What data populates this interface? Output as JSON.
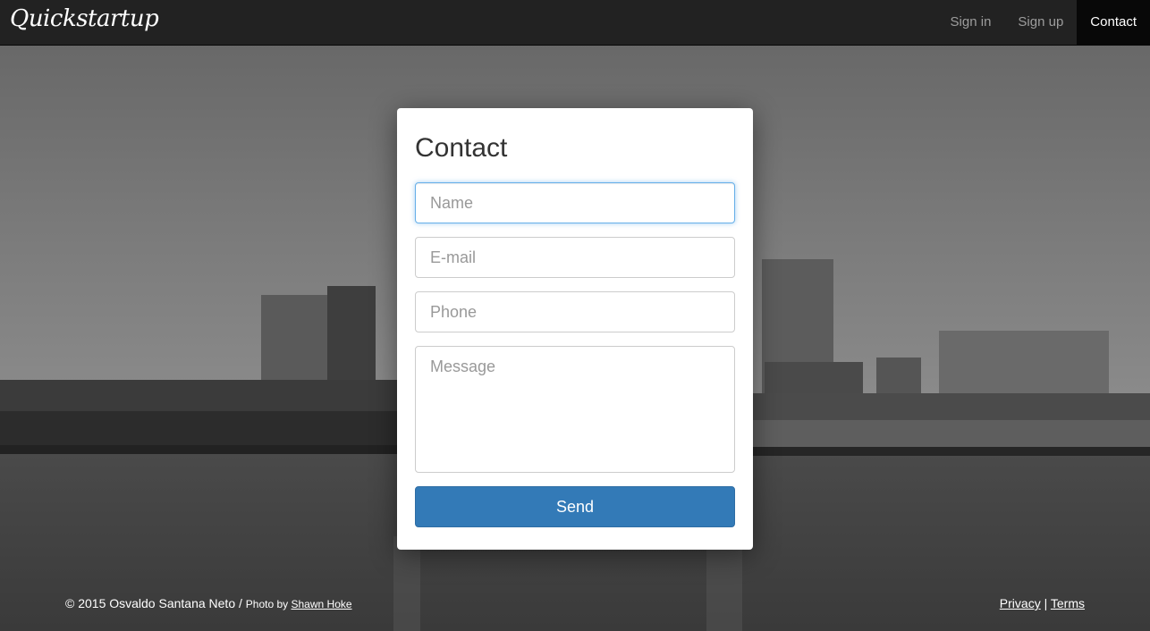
{
  "navbar": {
    "brand": "Quickstartup",
    "items": [
      {
        "label": "Sign in"
      },
      {
        "label": "Sign up"
      },
      {
        "label": "Contact",
        "active": true
      }
    ]
  },
  "contact_form": {
    "title": "Contact",
    "name_placeholder": "Name",
    "email_placeholder": "E-mail",
    "phone_placeholder": "Phone",
    "message_placeholder": "Message",
    "send_label": "Send"
  },
  "footer": {
    "copyright": "© 2015 Osvaldo Santana Neto /",
    "photo_by": "Photo by",
    "photographer": "Shawn Hoke",
    "privacy": "Privacy",
    "separator": "|",
    "terms": "Terms"
  },
  "colors": {
    "navbar_bg": "#222222",
    "active_nav_bg": "#080808",
    "primary_button": "#337ab7",
    "focus_border": "#66afe9"
  },
  "icons": [
    "city-skyline-background-image"
  ]
}
